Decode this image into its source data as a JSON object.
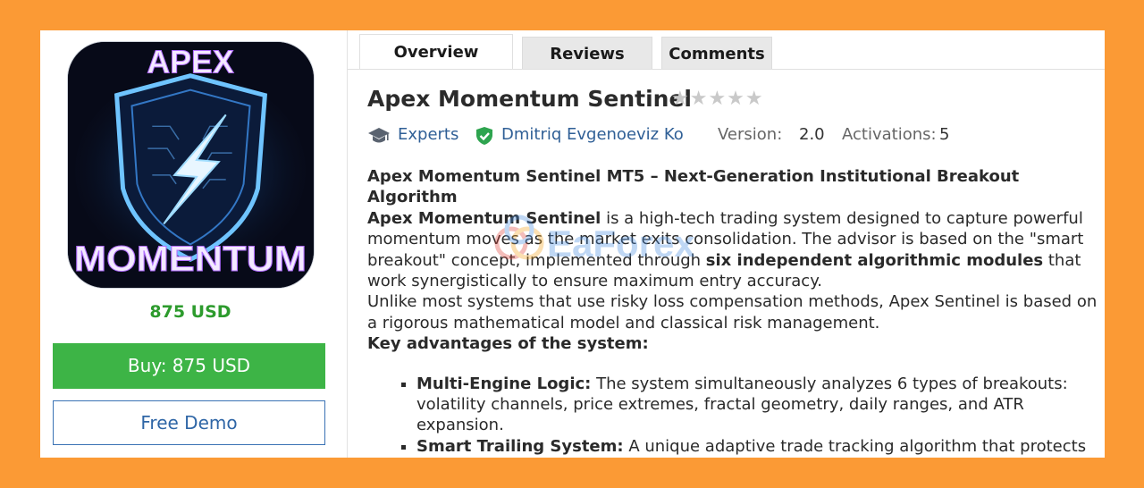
{
  "tabs": [
    {
      "label": "Overview"
    },
    {
      "label": "Reviews"
    },
    {
      "label": "Comments"
    }
  ],
  "product": {
    "title": "Apex Momentum Sentinel",
    "rating_stars": "★★★★★",
    "logo_top": "APEX",
    "logo_bottom": "MOMENTUM",
    "category": "Experts",
    "author": "Dmitriq Evgenoeviz Ko",
    "version_label": "Version:",
    "version": "2.0",
    "activations_label": "Activations:",
    "activations": "5",
    "price": "875 USD",
    "buy_label": "Buy: 875 USD",
    "demo_label": "Free Demo"
  },
  "description": {
    "heading": "Apex Momentum Sentinel MT5 – Next-Generation Institutional Breakout Algorithm",
    "p1_bold": "Apex Momentum Sentinel",
    "p1_a": " is a high-tech trading system designed to capture powerful momentum moves as the market exits consolidation. The advisor is based on the \"smart breakout\" concept, implemented through ",
    "p1_bold2": "six independent algorithmic modules",
    "p1_b": " that work synergistically to ensure maximum entry accuracy.",
    "p2": "Unlike most systems that use risky loss compensation methods, Apex Sentinel is based on a rigorous mathematical model and classical risk management.",
    "advantages_heading": "Key advantages of the system:",
    "items": [
      {
        "title": "Multi-Engine Logic:",
        "text": " The system simultaneously analyzes 6 types of breakouts: volatility channels, price extremes, fractal geometry, daily ranges, and ATR expansion."
      },
      {
        "title": "Smart Trailing System:",
        "text": " A unique adaptive trade tracking algorithm that protects accumulated profits by adjusting the Stop Loss according to the price, taking market noise into account."
      }
    ]
  },
  "watermark_text": "EaForex",
  "colors": {
    "background": "#fb9a35",
    "buy": "#3db446",
    "price": "#2d9b2d",
    "link": "#2f5f96"
  }
}
